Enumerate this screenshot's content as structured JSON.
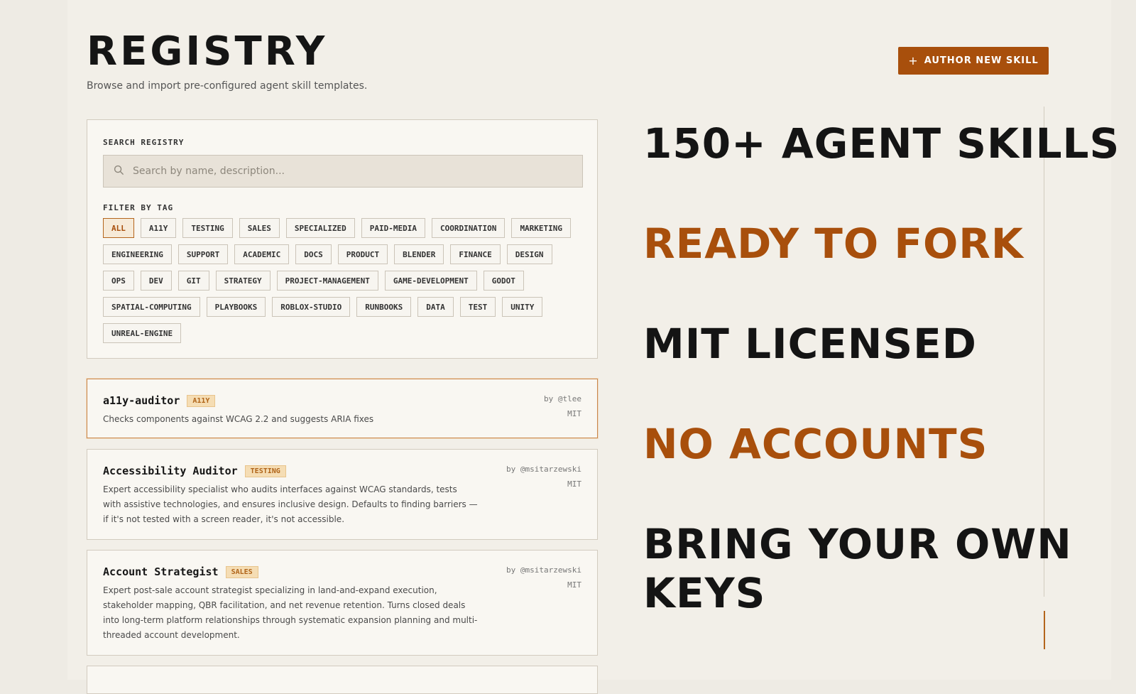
{
  "header": {
    "title": "REGISTRY",
    "subtitle": "Browse and import pre-configured agent skill templates.",
    "author_button": {
      "icon": "plus-icon",
      "label": "AUTHOR NEW SKILL"
    }
  },
  "search": {
    "label": "SEARCH REGISTRY",
    "placeholder": "Search by name, description...",
    "value": ""
  },
  "filter": {
    "label": "FILTER BY TAG",
    "active": "ALL",
    "tags": [
      "ALL",
      "A11Y",
      "TESTING",
      "SALES",
      "SPECIALIZED",
      "PAID-MEDIA",
      "COORDINATION",
      "MARKETING",
      "ENGINEERING",
      "SUPPORT",
      "ACADEMIC",
      "DOCS",
      "PRODUCT",
      "BLENDER",
      "FINANCE",
      "DESIGN",
      "OPS",
      "DEV",
      "GIT",
      "STRATEGY",
      "PROJECT-MANAGEMENT",
      "GAME-DEVELOPMENT",
      "GODOT",
      "SPATIAL-COMPUTING",
      "PLAYBOOKS",
      "ROBLOX-STUDIO",
      "RUNBOOKS",
      "DATA",
      "TEST",
      "UNITY",
      "UNREAL-ENGINE"
    ]
  },
  "skills": [
    {
      "name": "a11y-auditor",
      "tag": "A11Y",
      "author": "by @tlee",
      "license": "MIT",
      "description": "Checks components against WCAG 2.2 and suggests ARIA fixes"
    },
    {
      "name": "Accessibility Auditor",
      "tag": "TESTING",
      "author": "by @msitarzewski",
      "license": "MIT",
      "description": "Expert accessibility specialist who audits interfaces against WCAG standards, tests with assistive technologies, and ensures inclusive design. Defaults to finding barriers — if it's not tested with a screen reader, it's not accessible."
    },
    {
      "name": "Account Strategist",
      "tag": "SALES",
      "author": "by @msitarzewski",
      "license": "MIT",
      "description": "Expert post-sale account strategist specializing in land-and-expand execution, stakeholder mapping, QBR facilitation, and net revenue retention. Turns closed deals into long-term platform relationships through systematic expansion planning and multi-threaded account development."
    }
  ],
  "promo": {
    "lines": [
      "150+ AGENT SKILLS",
      "READY TO FORK",
      "MIT LICENSED",
      "NO ACCOUNTS",
      "BRING YOUR OWN KEYS"
    ],
    "colors": {
      "dark": "#141414",
      "accent": "#a84f0c"
    }
  }
}
